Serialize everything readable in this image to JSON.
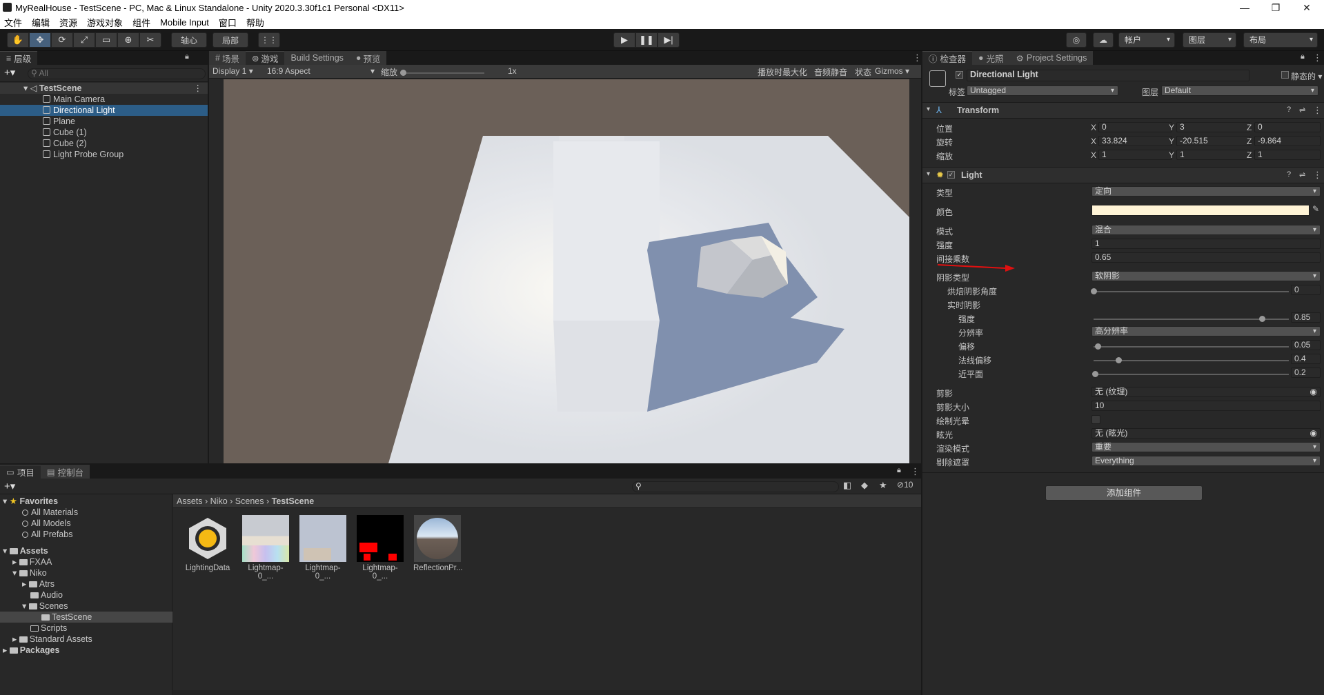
{
  "window": {
    "title": "MyRealHouse - TestScene - PC, Mac & Linux Standalone - Unity 2020.3.30f1c1 Personal <DX11>",
    "min": "—",
    "restore": "❐",
    "close": "✕"
  },
  "menu": [
    "文件",
    "编辑",
    "资源",
    "游戏对象",
    "组件",
    "Mobile Input",
    "窗口",
    "帮助"
  ],
  "toolbar": {
    "pivot": "轴心",
    "local": "局部",
    "account": "帐户",
    "layers": "图层",
    "layout": "布局"
  },
  "hierarchy": {
    "tab": "层级",
    "search_placeholder": "All",
    "scene": "TestScene",
    "items": [
      "Main Camera",
      "Directional Light",
      "Plane",
      "Cube (1)",
      "Cube (2)",
      "Light Probe Group"
    ]
  },
  "center_tabs": {
    "scene": "场景",
    "game": "游戏",
    "build": "Build Settings",
    "preview": "预览"
  },
  "game_bar": {
    "display": "Display 1",
    "aspect": "16:9 Aspect",
    "scale_label": "缩放",
    "scale_value": "1x",
    "maximize": "播放时最大化",
    "mute": "音频静音",
    "stats": "状态",
    "gizmos": "Gizmos"
  },
  "inspector": {
    "tabs": [
      "检查器",
      "光照",
      "Project Settings"
    ],
    "object_name": "Directional Light",
    "static": "静态的",
    "tag_label": "标签",
    "tag_value": "Untagged",
    "layer_label": "图层",
    "layer_value": "Default",
    "transform": {
      "title": "Transform",
      "rows": [
        {
          "label": "位置",
          "x": "0",
          "y": "3",
          "z": "0"
        },
        {
          "label": "旋转",
          "x": "33.824",
          "y": "-20.515",
          "z": "-9.864"
        },
        {
          "label": "缩放",
          "x": "1",
          "y": "1",
          "z": "1"
        }
      ]
    },
    "light": {
      "title": "Light",
      "type_label": "类型",
      "type_value": "定向",
      "color_label": "颜色",
      "color_hex": "#fff4d6",
      "mode_label": "模式",
      "mode_value": "混合",
      "intensity_label": "强度",
      "intensity_value": "1",
      "indirect_label": "间接乘数",
      "indirect_value": "0.65",
      "shadow_type_label": "阴影类型",
      "shadow_type_value": "软阴影",
      "baked_angle_label": "烘焙阴影角度",
      "baked_angle_value": "0",
      "realtime_label": "实时阴影",
      "strength_label": "强度",
      "strength_value": "0.85",
      "resolution_label": "分辨率",
      "resolution_value": "高分辨率",
      "bias_label": "偏移",
      "bias_value": "0.05",
      "normal_bias_label": "法线偏移",
      "normal_bias_value": "0.4",
      "near_plane_label": "近平面",
      "near_plane_value": "0.2",
      "cookie_label": "剪影",
      "cookie_value": "无 (纹理)",
      "cookie_size_label": "剪影大小",
      "cookie_size_value": "10",
      "draw_halo_label": "绘制光晕",
      "flare_label": "眩光",
      "flare_value": "无 (眩光)",
      "render_mode_label": "渲染模式",
      "render_mode_value": "重要",
      "culling_label": "剔除遮罩",
      "culling_value": "Everything"
    },
    "add_component": "添加组件"
  },
  "project": {
    "tabs": [
      "项目",
      "控制台"
    ],
    "hidden_count": "10",
    "favorites": {
      "title": "Favorites",
      "items": [
        "All Materials",
        "All Models",
        "All Prefabs"
      ]
    },
    "tree": {
      "assets": "Assets",
      "fxaa": "FXAA",
      "niko": "Niko",
      "atrs": "Atrs",
      "audio": "Audio",
      "scenes": "Scenes",
      "testscene": "TestScene",
      "scripts": "Scripts",
      "standard": "Standard Assets",
      "packages": "Packages"
    },
    "breadcrumb": [
      "Assets",
      "Niko",
      "Scenes",
      "TestScene"
    ],
    "assets": [
      "LightingData",
      "Lightmap-0_...",
      "Lightmap-0_...",
      "Lightmap-0_...",
      "ReflectionPr..."
    ]
  },
  "colors": {
    "accent": "#2c5d87",
    "annotation_arrow": "#e01010"
  }
}
